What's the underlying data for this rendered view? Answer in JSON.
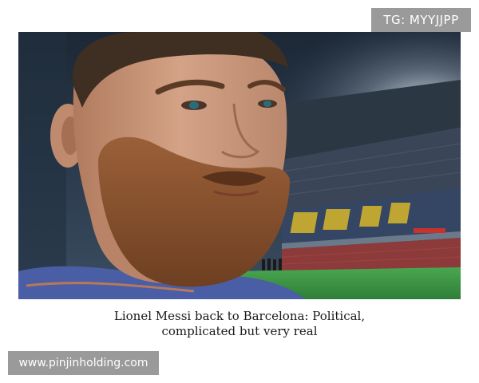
{
  "watermark_top": {
    "text": "TG: MYYJJPP"
  },
  "photo": {
    "subject": "player-portrait",
    "colors": {
      "sky": "#2a3a4c",
      "skin": "#c99579",
      "beard": "#8a5330",
      "hair": "#3f2e22",
      "pitch": "#3f9a47",
      "stands": "#3d4a5e",
      "seat_text": "#e2c229"
    }
  },
  "caption": {
    "line1": "Lionel Messi back to Barcelona: Political,",
    "line2": "complicated but very real"
  },
  "watermark_bottom": {
    "text": "www.pinjinholding.com"
  }
}
